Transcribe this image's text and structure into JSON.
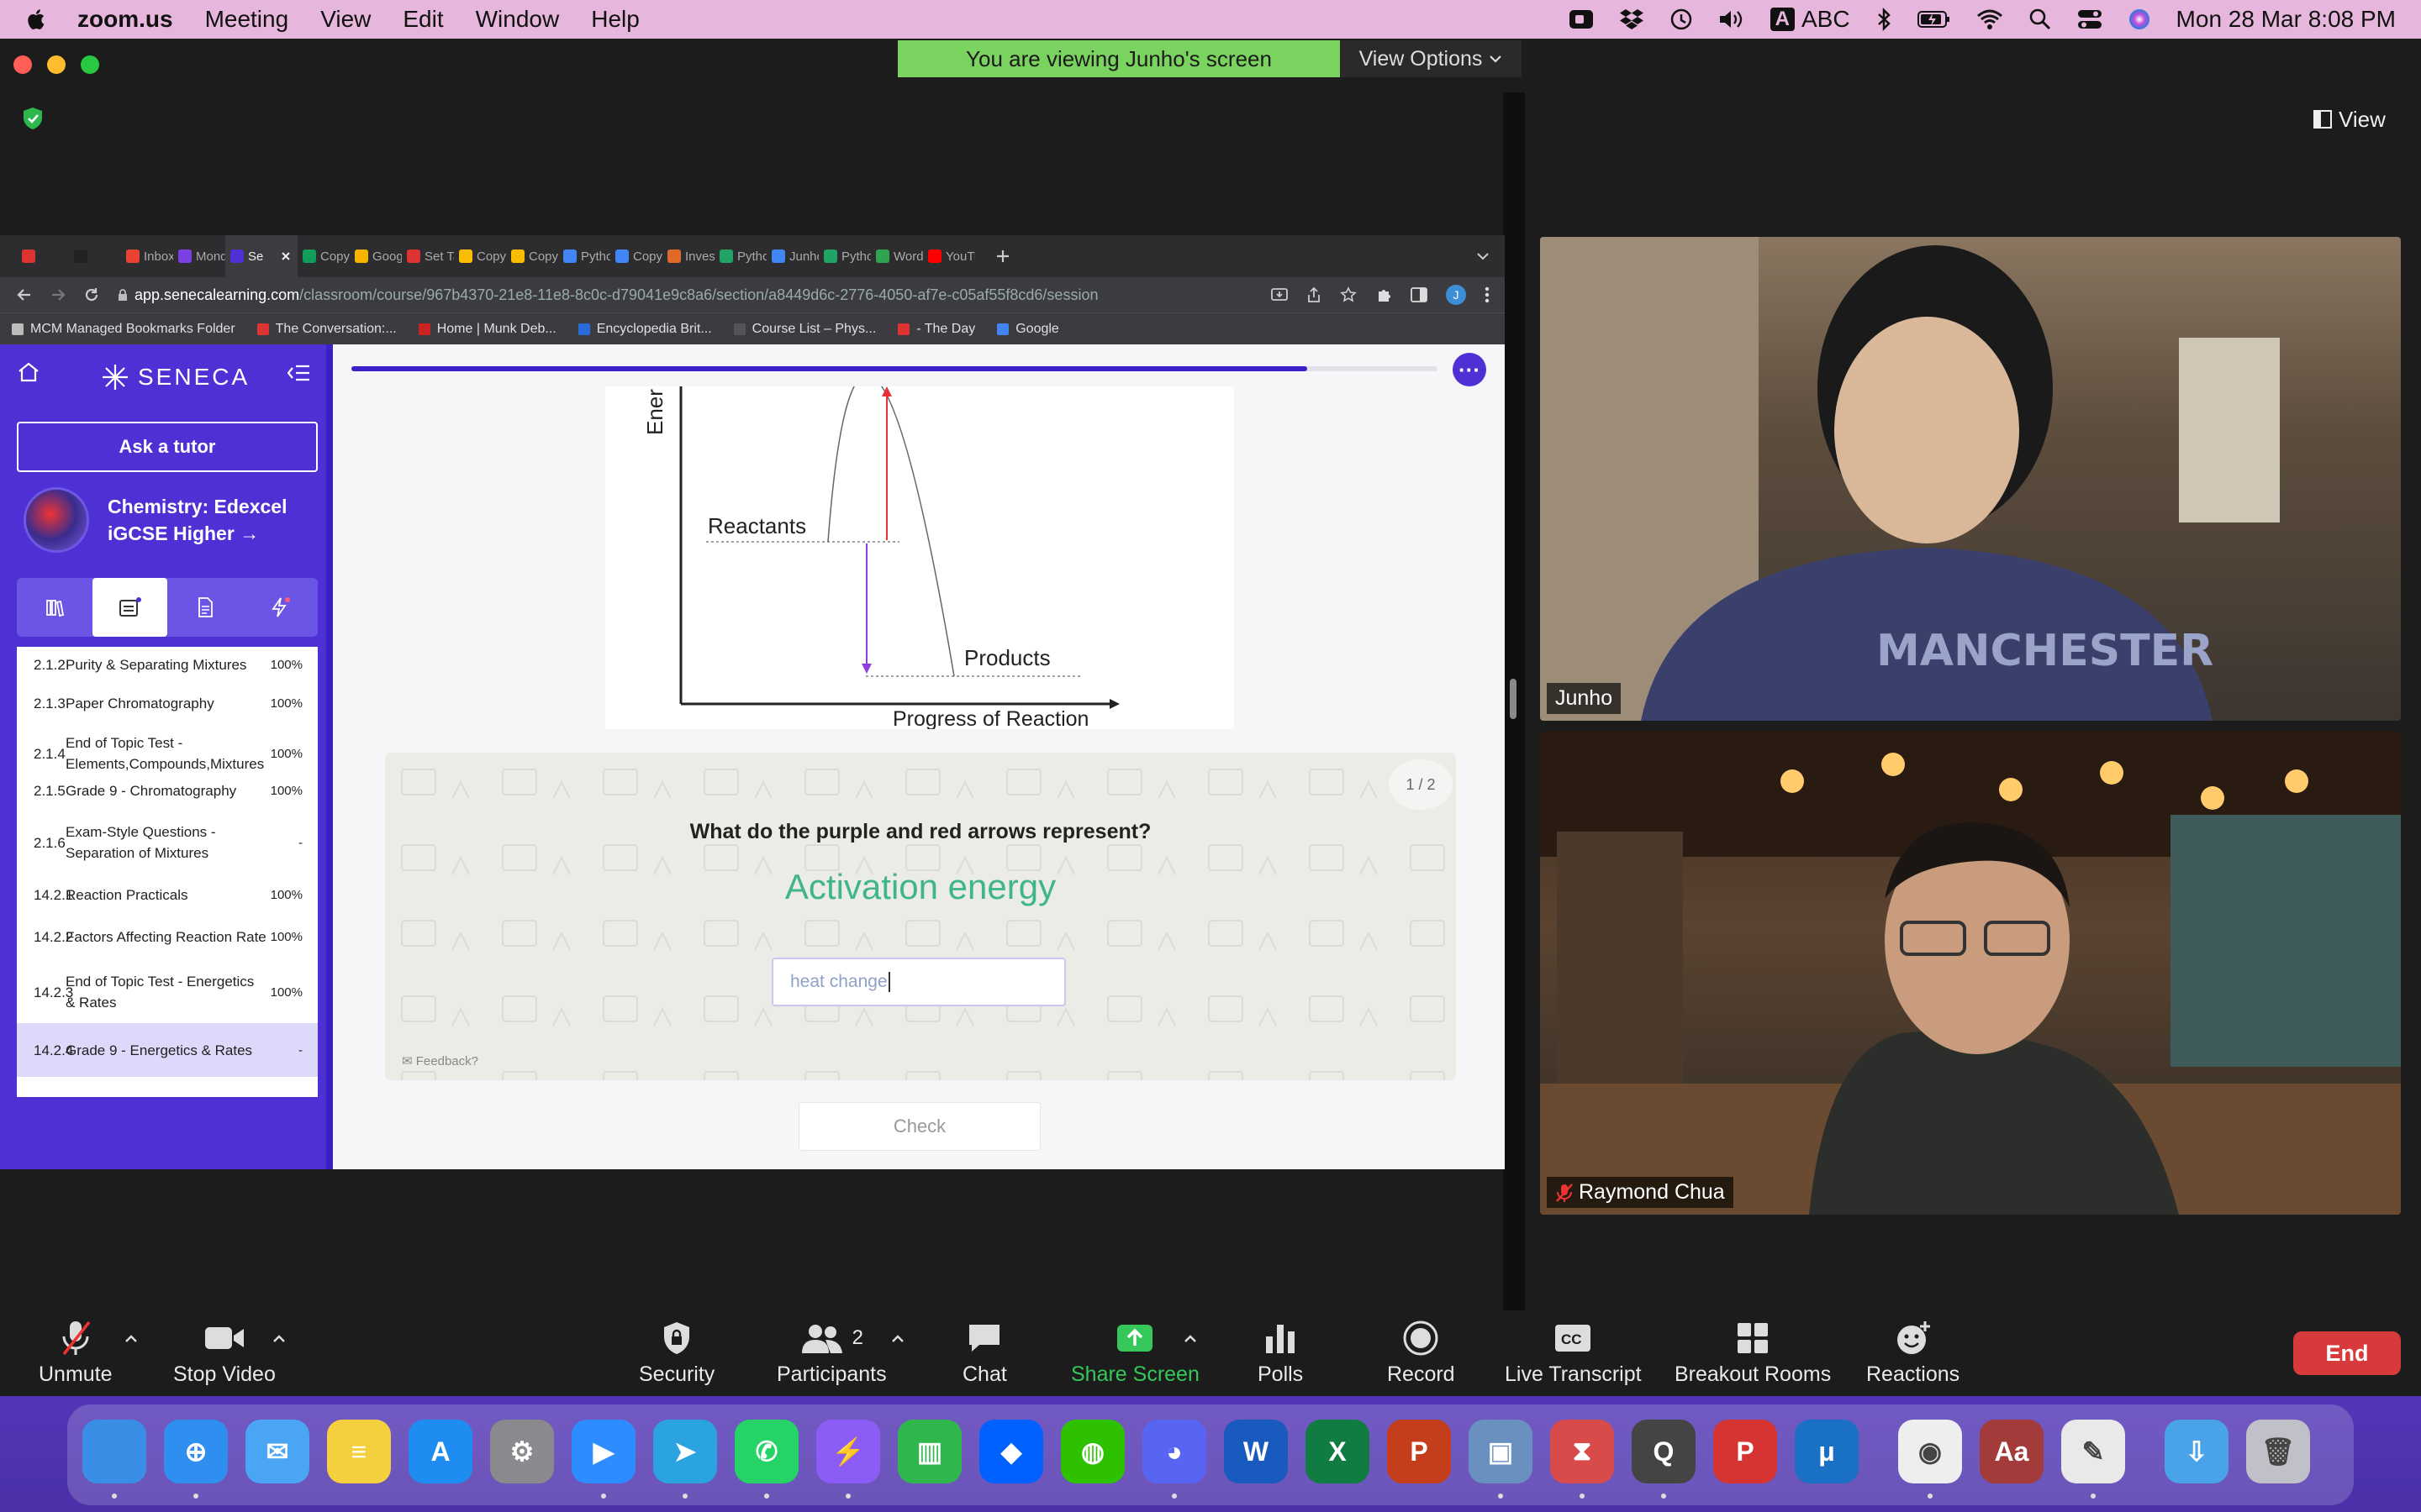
{
  "menubar": {
    "apple": "",
    "app": "zoom.us",
    "items": [
      "Meeting",
      "View",
      "Edit",
      "Window",
      "Help"
    ],
    "input_source": "ABC",
    "datetime": "Mon 28 Mar  8:08 PM"
  },
  "zoom": {
    "banner": "You are viewing Junho's screen",
    "view_options": "View Options",
    "view_button": "View",
    "participants": [
      {
        "name": "Junho",
        "muted": false
      },
      {
        "name": "Raymond Chua",
        "muted": true
      }
    ],
    "toolbar": {
      "unmute": "Unmute",
      "stop_video": "Stop Video",
      "security": "Security",
      "participants": "Participants",
      "participant_count": "2",
      "chat": "Chat",
      "share_screen": "Share Screen",
      "polls": "Polls",
      "record": "Record",
      "live_transcript": "Live Transcript",
      "breakout_rooms": "Breakout Rooms",
      "reactions": "Reactions",
      "end": "End"
    }
  },
  "browser": {
    "tabs": [
      {
        "label": "",
        "color": "#d33"
      },
      {
        "label": "",
        "color": "#222"
      },
      {
        "label": "Inbox",
        "color": "#ea4335"
      },
      {
        "label": "Monda",
        "color": "#7b3fe4"
      },
      {
        "label": "Se",
        "color": "#4e30d5",
        "active": true
      },
      {
        "label": "Copy",
        "color": "#0f9d58"
      },
      {
        "label": "Googl",
        "color": "#f4b400"
      },
      {
        "label": "Set Ta",
        "color": "#d33"
      },
      {
        "label": "Copy",
        "color": "#fbbc04"
      },
      {
        "label": "Copy",
        "color": "#fbbc04"
      },
      {
        "label": "Pytho",
        "color": "#4285f4"
      },
      {
        "label": "Copy",
        "color": "#4285f4"
      },
      {
        "label": "Invest",
        "color": "#e06a2c"
      },
      {
        "label": "Pytho",
        "color": "#21a366"
      },
      {
        "label": "Junho",
        "color": "#4285f4"
      },
      {
        "label": "Pytho",
        "color": "#21a366"
      },
      {
        "label": "WordI",
        "color": "#2ea44f"
      },
      {
        "label": "YouTu",
        "color": "#ff0000"
      }
    ],
    "url_host": "app.senecalearning.com",
    "url_path": "/classroom/course/967b4370-21e8-11e8-8c0c-d79041e9c8a6/section/a8449d6c-2776-4050-af7e-c05af55f8cd6/session",
    "profile_initial": "J",
    "bookmarks": [
      {
        "label": "MCM Managed Bookmarks Folder",
        "color": "#bbb"
      },
      {
        "label": "The Conversation:...",
        "color": "#d33"
      },
      {
        "label": "Home | Munk Deb...",
        "color": "#c22"
      },
      {
        "label": "Encyclopedia Brit...",
        "color": "#2a6ad8"
      },
      {
        "label": "Course List – Phys...",
        "color": "#555"
      },
      {
        "label": "- The Day",
        "color": "#d33"
      },
      {
        "label": "Google",
        "color": "#4285f4"
      }
    ]
  },
  "seneca": {
    "logo": "SENECA",
    "ask_tutor": "Ask a tutor",
    "course_title_1": "Chemistry: Edexcel",
    "course_title_2": "iGCSE Higher →",
    "topics": [
      {
        "num": "2.1.2",
        "name": "Purity & Separating Mixtures",
        "pct": "100%"
      },
      {
        "num": "2.1.3",
        "name": "Paper Chromatography",
        "pct": "100%"
      },
      {
        "num": "2.1.4",
        "name": "End of Topic Test - Elements,Compounds,Mixtures",
        "pct": "100%"
      },
      {
        "num": "2.1.5",
        "name": "Grade 9 - Chromatography",
        "pct": "100%"
      },
      {
        "num": "2.1.6",
        "name": "Exam-Style Questions - Separation of Mixtures",
        "pct": "-"
      },
      {
        "num": "14.2.1",
        "name": "Reaction Practicals",
        "pct": "100%"
      },
      {
        "num": "14.2.2",
        "name": "Factors Affecting Reaction Rate",
        "pct": "100%"
      },
      {
        "num": "14.2.3",
        "name": "End of Topic Test - Energetics & Rates",
        "pct": "100%"
      },
      {
        "num": "14.2.4",
        "name": "Grade 9 - Energetics & Rates",
        "pct": "-",
        "selected": true
      }
    ],
    "progress_fraction": 0.88,
    "diagram": {
      "y_label": "Ener",
      "x_label": "Progress of Reaction",
      "reactants": "Reactants",
      "products": "Products"
    },
    "question": "What do the purple and red arrows represent?",
    "answer_shown": "Activation energy",
    "input_value": "heat change",
    "page_current": "1",
    "page_total": "2",
    "feedback": "Feedback?",
    "check": "Check",
    "more": "···"
  }
}
